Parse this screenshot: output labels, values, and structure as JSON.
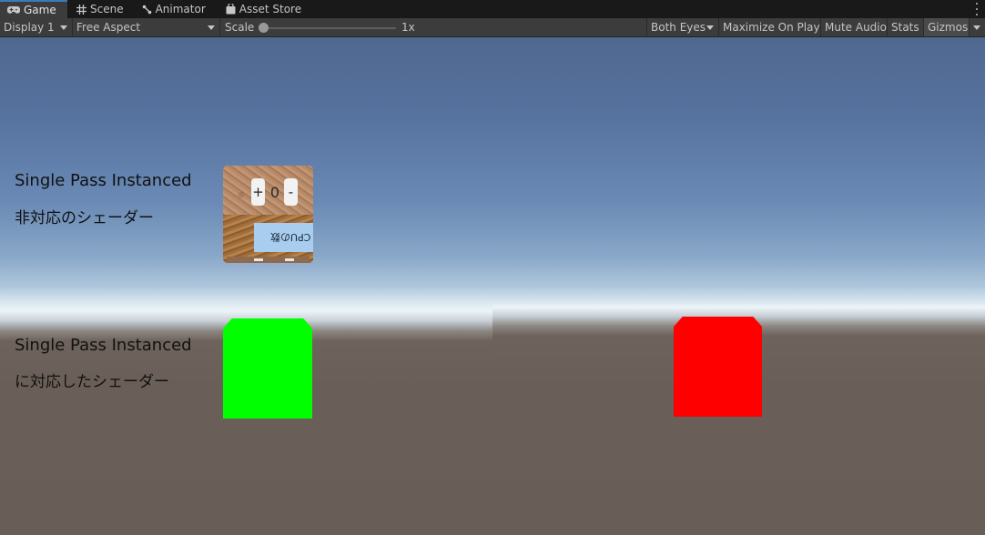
{
  "tabs": [
    {
      "label": "Game",
      "icon": "gamepad-icon",
      "active": true
    },
    {
      "label": "Scene",
      "icon": "grid-icon",
      "active": false
    },
    {
      "label": "Animator",
      "icon": "animator-icon",
      "active": false
    },
    {
      "label": "Asset Store",
      "icon": "shopping-bag-icon",
      "active": false
    }
  ],
  "toolbar": {
    "display": "Display 1",
    "aspect": "Free Aspect",
    "scale_label": "Scale",
    "scale_value": "1x",
    "scale_level": 0,
    "eyes": "Both Eyes",
    "maximize": "Maximize On Play",
    "mute": "Mute Audio",
    "stats": "Stats",
    "gizmos": "Gizmos"
  },
  "scene": {
    "label1_line1": "Single Pass Instanced",
    "label1_line2": "非対応のシェーダー",
    "label2_line1": "Single Pass Instanced",
    "label2_line2": "に対応したシェーダー",
    "ui_plus": "+",
    "ui_counter": "0",
    "ui_minus": "-",
    "ui_cpu": "CPUの数",
    "colors": {
      "supported_left_eye": "#00ff00",
      "supported_right_eye": "#ff0000"
    }
  }
}
